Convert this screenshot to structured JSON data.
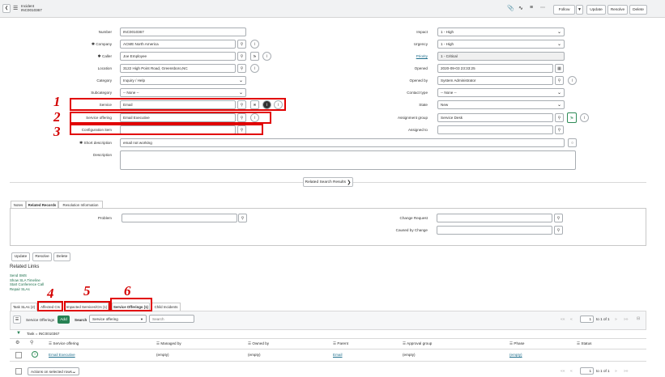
{
  "header": {
    "title": "Incident",
    "number": "INC0010367",
    "follow": "Follow",
    "update": "Update",
    "resolve": "Resolve",
    "delete": "Delete"
  },
  "form": {
    "number": {
      "label": "Number",
      "value": "INC0010367"
    },
    "company": {
      "label": "Company",
      "value": "ACME North America"
    },
    "caller": {
      "label": "Caller",
      "value": "Joe Employee"
    },
    "location": {
      "label": "Location",
      "value": "3122 High Point Road, Greensboro,NC"
    },
    "category": {
      "label": "Category",
      "value": "Inquiry / Help"
    },
    "subcategory": {
      "label": "Subcategory",
      "value": "-- None --"
    },
    "service": {
      "label": "Service",
      "value": "Email"
    },
    "service_offering": {
      "label": "Service offering",
      "value": "Email Executive"
    },
    "configuration_item": {
      "label": "Configuration item",
      "value": ""
    },
    "short_description": {
      "label": "Short description",
      "value": "email not working"
    },
    "description": {
      "label": "Description",
      "value": ""
    },
    "impact": {
      "label": "Impact",
      "value": "1 - High"
    },
    "urgency": {
      "label": "Urgency",
      "value": "1 - High"
    },
    "priority": {
      "label": "Priority",
      "value": "1 - Critical"
    },
    "opened": {
      "label": "Opened",
      "value": "2020-09-03 23:33:25"
    },
    "opened_by": {
      "label": "Opened by",
      "value": "System Administrator"
    },
    "contact_type": {
      "label": "Contact type",
      "value": "-- None --"
    },
    "state": {
      "label": "State",
      "value": "New"
    },
    "assignment_group": {
      "label": "Assignment group",
      "value": "Service Desk"
    },
    "assigned_to": {
      "label": "Assigned to",
      "value": ""
    },
    "related_search": "Related Search Results"
  },
  "section_tabs": [
    "Notes",
    "Related Records",
    "Resolution Information"
  ],
  "related": {
    "problem": "Problem",
    "change_request": "Change Request",
    "caused_by_change": "Caused by Change"
  },
  "bottom_buttons": [
    "Update",
    "Resolve",
    "Delete"
  ],
  "related_links": {
    "title": "Related Links",
    "items": [
      "Send SMS",
      "Show SLA Timeline",
      "Start Conference Call",
      "Repair SLAs"
    ]
  },
  "list_tabs": [
    "Task SLAs (2)",
    "Affected CIs",
    "Impacted Services/CIs (1)",
    "Service Offerings (1)",
    "Child Incidents"
  ],
  "list": {
    "menu_label": "Service Offerings",
    "add": "Add",
    "search": "Search",
    "search_field": "Service offering",
    "search_placeholder": "Search",
    "filter": "Task = INC0010367",
    "pager_page": "1",
    "pager_total": "to 1 of 1",
    "columns": [
      "Service offering",
      "Managed by",
      "Owned by",
      "Parent",
      "Approval group",
      "Phase",
      "Status"
    ],
    "rows": [
      [
        "Email Executive",
        "(empty)",
        "(empty)",
        "Email",
        "(empty)",
        "(empty)",
        ""
      ]
    ],
    "actions": "Actions on selected rows..."
  },
  "annotations": [
    "1",
    "2",
    "3",
    "4",
    "5",
    "6"
  ]
}
